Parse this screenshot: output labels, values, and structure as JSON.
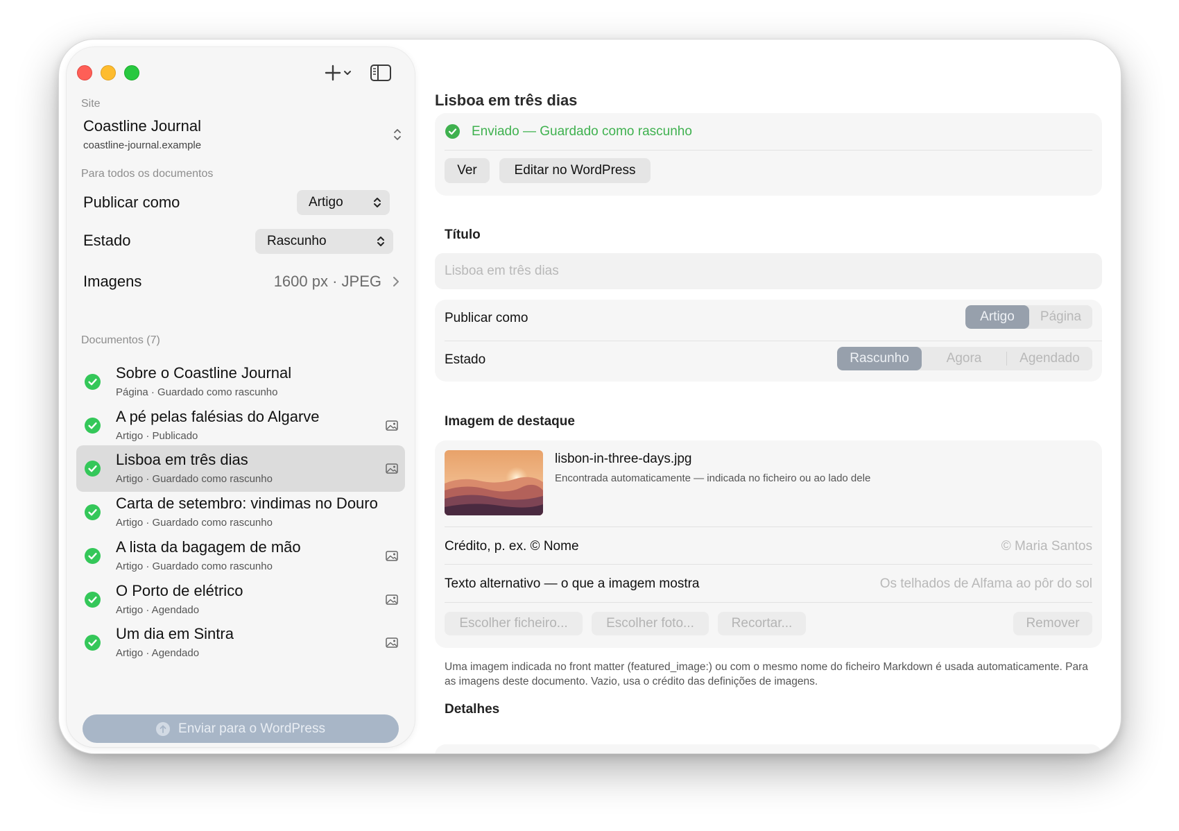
{
  "sidebar": {
    "site_label": "Site",
    "site_name": "Coastline Journal",
    "site_url": "coastline-journal.example",
    "all_docs_label": "Para todos os documentos",
    "publish_as_label": "Publicar como",
    "publish_as_value": "Artigo",
    "status_label": "Estado",
    "status_value": "Rascunho",
    "images_label": "Imagens",
    "images_value": "1600 px · JPEG",
    "documents_label": "Documentos (7)",
    "documents": [
      {
        "title": "Sobre o Coastline Journal",
        "subtitle": "Página · Guardado como rascunho",
        "has_image": false,
        "selected": false
      },
      {
        "title": "A pé pelas falésias do Algarve",
        "subtitle": "Artigo · Publicado",
        "has_image": true,
        "selected": false
      },
      {
        "title": "Lisboa em três dias",
        "subtitle": "Artigo · Guardado como rascunho",
        "has_image": true,
        "selected": true
      },
      {
        "title": "Carta de setembro: vindimas no Douro",
        "subtitle": "Artigo · Guardado como rascunho",
        "has_image": false,
        "selected": false
      },
      {
        "title": "A lista da bagagem de mão",
        "subtitle": "Artigo · Guardado como rascunho",
        "has_image": true,
        "selected": false
      },
      {
        "title": "O Porto de elétrico",
        "subtitle": "Artigo · Agendado",
        "has_image": true,
        "selected": false
      },
      {
        "title": "Um dia em Sintra",
        "subtitle": "Artigo · Agendado",
        "has_image": true,
        "selected": false
      }
    ],
    "send_button": "Enviar para o WordPress"
  },
  "main": {
    "title": "Lisboa em três dias",
    "status_text": "Enviado — Guardado como rascunho",
    "view_button": "Ver",
    "edit_button": "Editar no WordPress",
    "title_section": "Título",
    "title_placeholder": "Lisboa em três dias",
    "publish_as_label": "Publicar como",
    "publish_as_options": [
      "Artigo",
      "Página"
    ],
    "publish_as_selected": "Artigo",
    "status_label": "Estado",
    "status_options": [
      "Rascunho",
      "Agora",
      "Agendado"
    ],
    "status_selected": "Rascunho",
    "featured_section": "Imagem de destaque",
    "file_name": "lisbon-in-three-days.jpg",
    "file_note": "Encontrada automaticamente — indicada no ficheiro ou ao lado dele",
    "credit_label": "Crédito, p. ex. © Nome",
    "credit_placeholder": "© Maria Santos",
    "alt_label": "Texto alternativo — o que a imagem mostra",
    "alt_placeholder": "Os telhados de Alfama ao pôr do sol",
    "choose_file": "Escolher ficheiro...",
    "choose_photo": "Escolher foto...",
    "crop": "Recortar...",
    "remove": "Remover",
    "note": "Uma imagem indicada no front matter (featured_image:) ou com o mesmo nome do ficheiro Markdown é usada automaticamente. Para as imagens deste documento. Vazio, usa o crédito das definições de imagens.",
    "details_section": "Detalhes"
  },
  "colors": {
    "success": "#3fb14f",
    "selected_segment": "#97a0ac",
    "send_button": "#a8b6c7"
  },
  "icons": {
    "check": "check-circle-icon",
    "image": "image-icon",
    "add": "plus-icon",
    "sidebar": "sidebar-toggle-icon"
  }
}
